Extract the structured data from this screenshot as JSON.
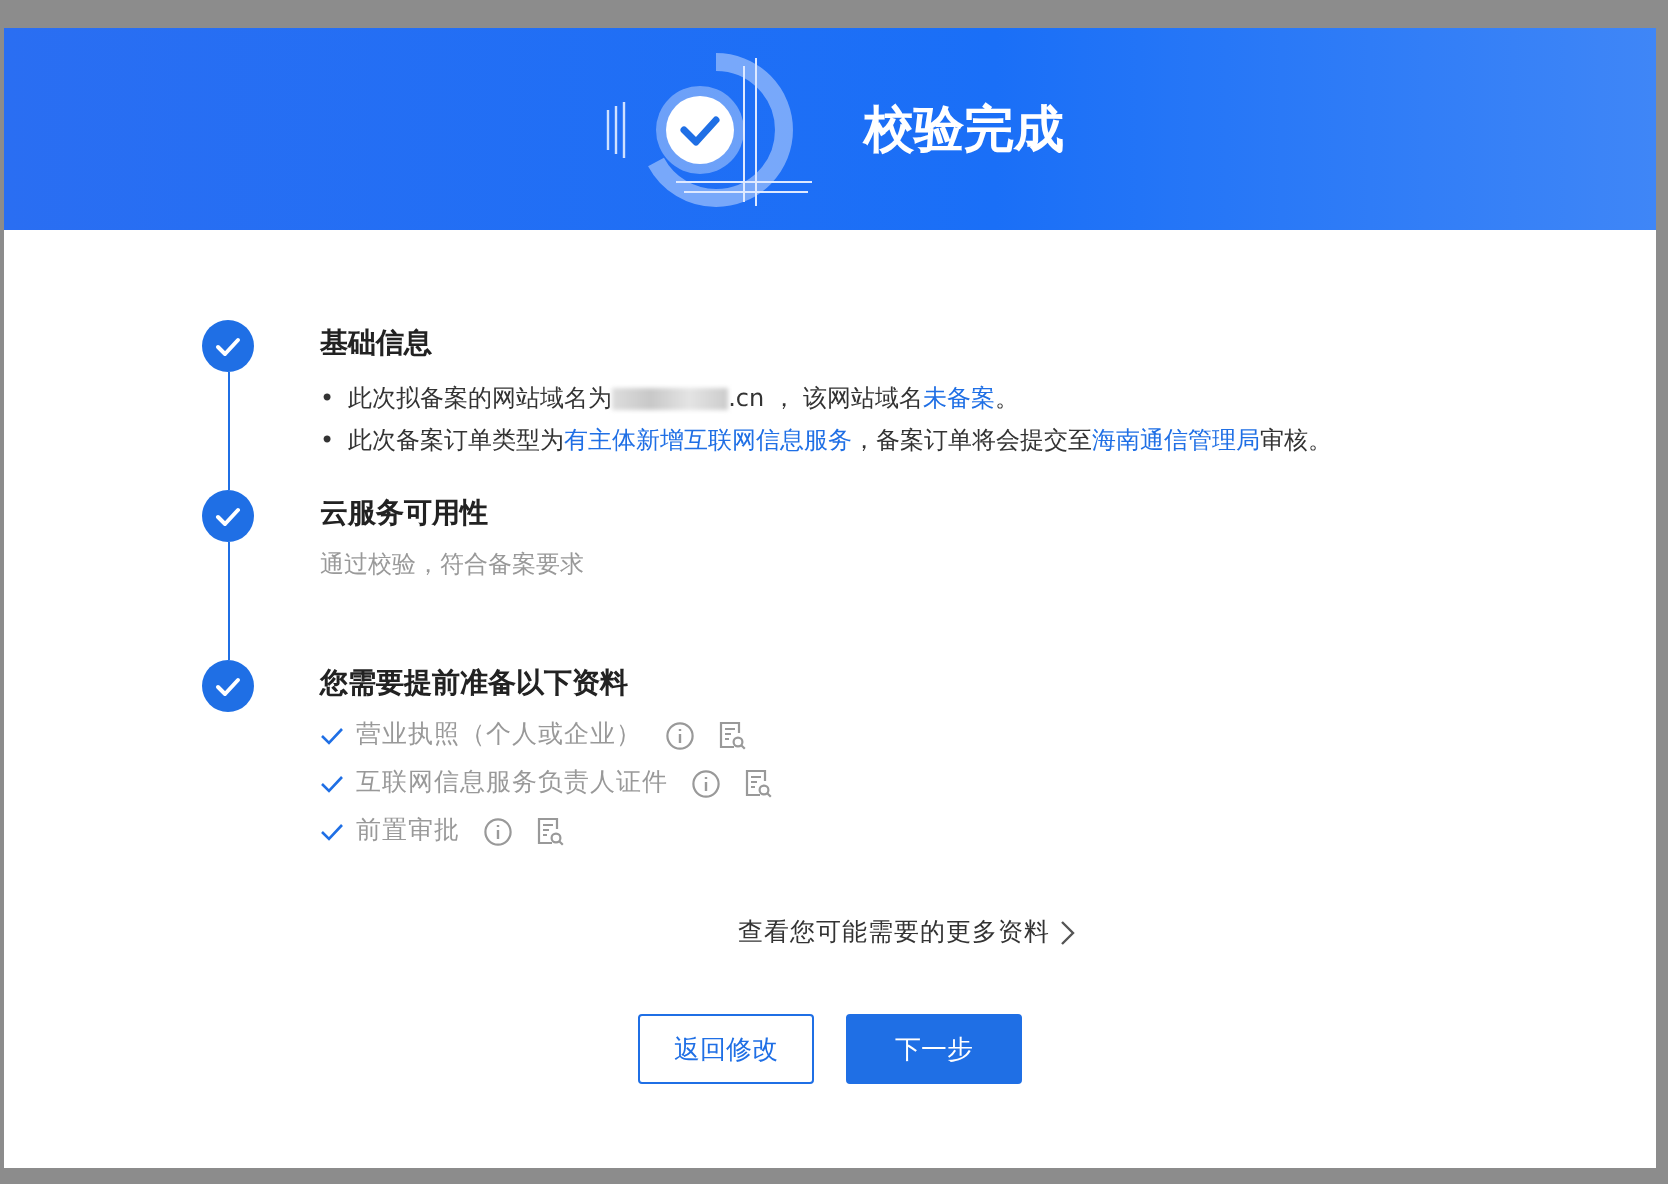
{
  "dialog": {
    "title": "校验完成"
  },
  "steps": [
    {
      "title": "基础信息",
      "completed": true,
      "kind": "bullets",
      "bullets": [
        {
          "marker": "•",
          "segments": [
            {
              "kind": "plain",
              "text": "此次拟备案的网站域名为"
            },
            {
              "kind": "redacted"
            },
            {
              "kind": "plain",
              "text": ".cn ， 该网站域名"
            },
            {
              "kind": "link",
              "text": "未备案"
            },
            {
              "kind": "plain",
              "text": "。"
            }
          ]
        },
        {
          "marker": "•",
          "segments": [
            {
              "kind": "plain",
              "text": "此次备案订单类型为"
            },
            {
              "kind": "link",
              "text": "有主体新增互联网信息服务"
            },
            {
              "kind": "plain",
              "text": "，备案订单将会提交至"
            },
            {
              "kind": "link",
              "text": "海南通信管理局"
            },
            {
              "kind": "plain",
              "text": "审核。"
            }
          ]
        }
      ]
    },
    {
      "title": "云服务可用性",
      "completed": true,
      "kind": "note",
      "note": "通过校验，符合备案要求"
    },
    {
      "title": "您需要提前准备以下资料",
      "completed": true,
      "kind": "checklist",
      "items": [
        {
          "label": "营业执照（个人或企业）",
          "checked": true
        },
        {
          "label": "互联网信息服务负责人证件",
          "checked": true
        },
        {
          "label": "前置审批",
          "checked": true
        }
      ]
    }
  ],
  "more_link": "查看您可能需要的更多资料",
  "buttons": [
    {
      "label": "返回修改",
      "kind": "secondary"
    },
    {
      "label": "下一步",
      "kind": "primary"
    }
  ]
}
